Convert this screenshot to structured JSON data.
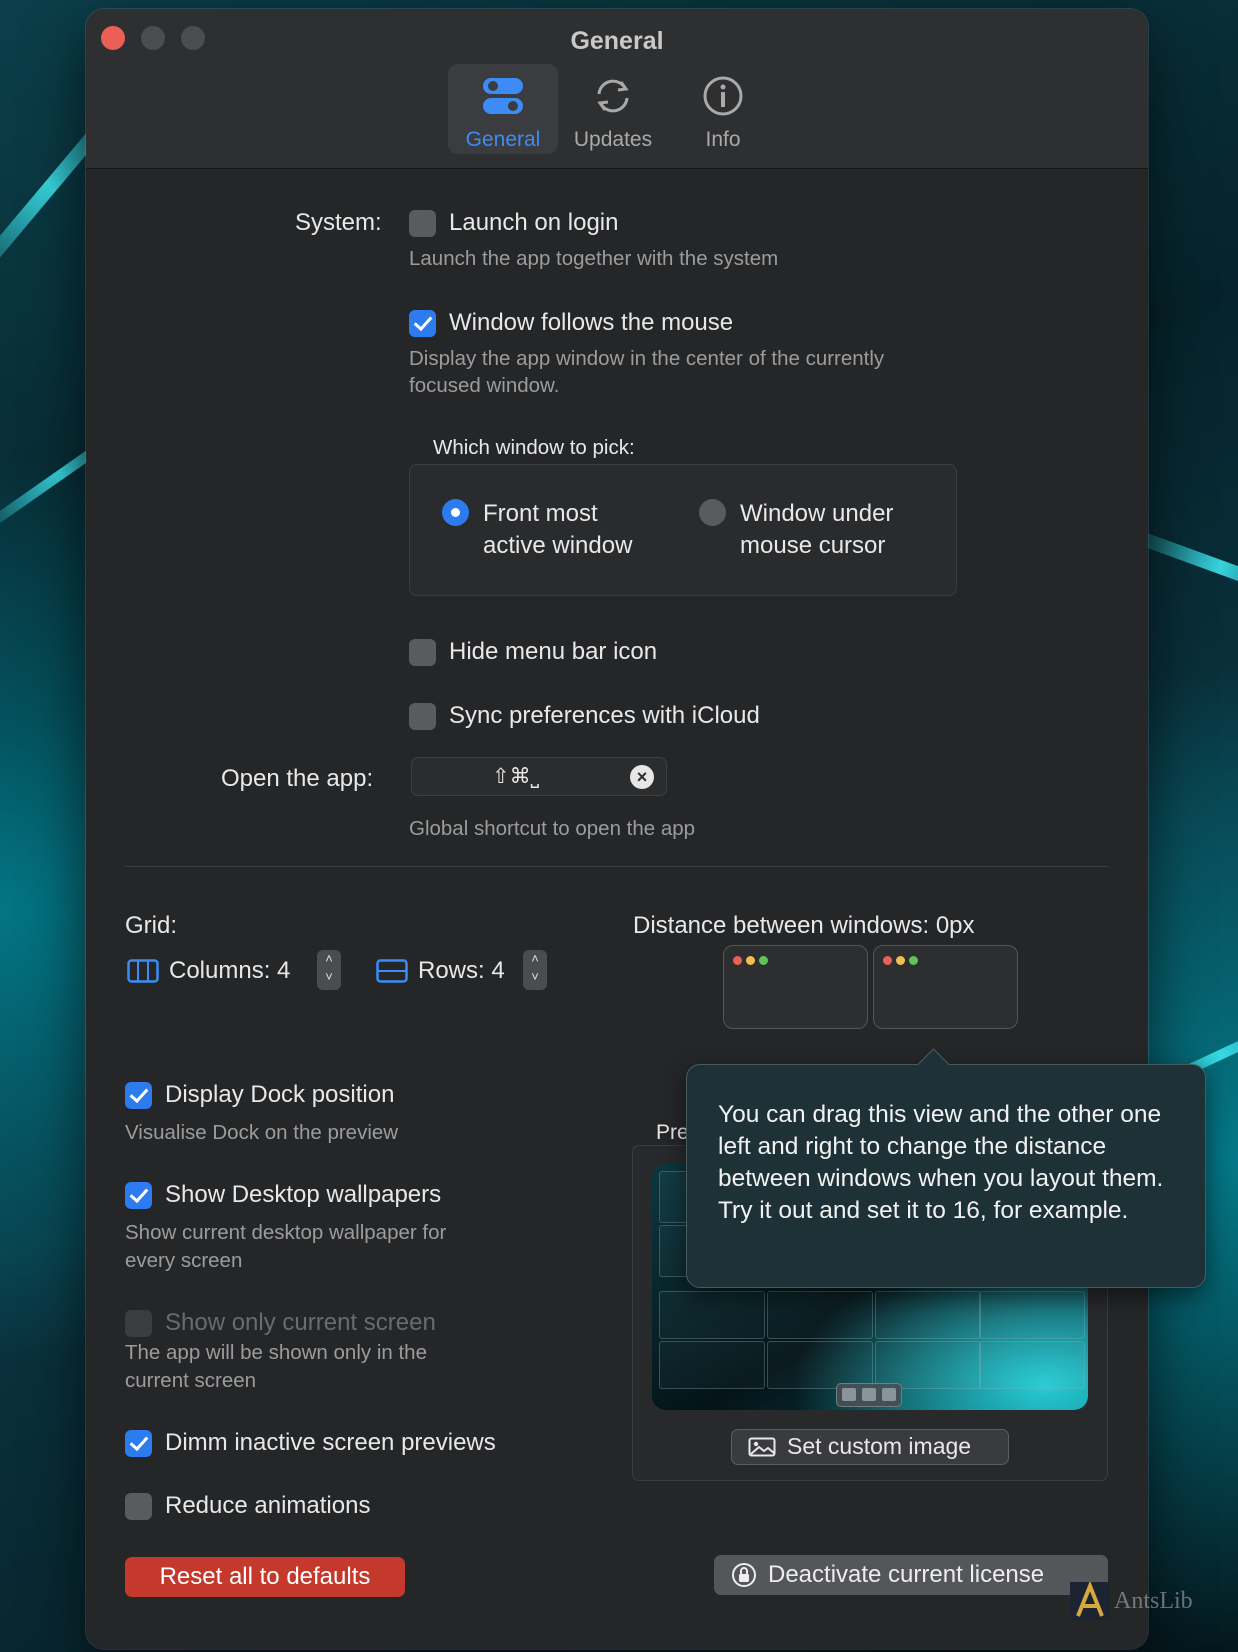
{
  "window": {
    "title": "General"
  },
  "tabs": [
    {
      "label": "General",
      "icon": "toggles-icon",
      "active": true
    },
    {
      "label": "Updates",
      "icon": "refresh-icon",
      "active": false
    },
    {
      "label": "Info",
      "icon": "info-icon",
      "active": false
    }
  ],
  "system": {
    "label": "System:",
    "launch_on_login": {
      "label": "Launch on login",
      "checked": false,
      "description": "Launch the app together with the system"
    },
    "window_follows_mouse": {
      "label": "Window follows the mouse",
      "checked": true,
      "description_line1": "Display the app window in the center of the currently",
      "description_line2": "focused window."
    },
    "which_window": {
      "title": "Which window to pick:",
      "options": [
        {
          "line1": "Front most",
          "line2": "active window",
          "selected": true
        },
        {
          "line1": "Window under",
          "line2": "mouse cursor",
          "selected": false
        }
      ]
    },
    "hide_menu_bar_icon": {
      "label": "Hide menu bar icon",
      "checked": false
    },
    "sync_icloud": {
      "label": "Sync preferences with iCloud",
      "checked": false
    }
  },
  "open_app": {
    "label": "Open the app:",
    "shortcut": "⇧⌘⎵",
    "description": "Global shortcut to open the app"
  },
  "grid": {
    "label": "Grid:",
    "columns_label": "Columns: 4",
    "rows_label": "Rows: 4",
    "columns": 4,
    "rows": 4
  },
  "distance": {
    "label": "Distance between windows: 0px"
  },
  "options": {
    "display_dock": {
      "label": "Display Dock position",
      "checked": true,
      "description": "Visualise Dock on the preview"
    },
    "show_wallpapers": {
      "label": "Show Desktop wallpapers",
      "checked": true,
      "description_line1": "Show current desktop wallpaper for",
      "description_line2": "every screen"
    },
    "only_current_screen": {
      "label": "Show only current screen",
      "checked": false,
      "disabled": true,
      "description_line1": "The app will be shown only in the",
      "description_line2": "current screen"
    },
    "dimm_inactive": {
      "label": "Dimm inactive screen previews",
      "checked": true
    },
    "reduce_animations": {
      "label": "Reduce animations",
      "checked": false
    }
  },
  "preview": {
    "label_partial": "Pre",
    "custom_image_button": "Set custom image"
  },
  "tooltip": {
    "text": "You can drag this view and the other one left and right to change the distance between windows when you layout them. Try it out and set it to 16, for example."
  },
  "buttons": {
    "reset": "Reset all to defaults",
    "deactivate": "Deactivate current license"
  },
  "watermark": {
    "text": "AntsLib"
  },
  "colors": {
    "accent": "#2c7cf0",
    "danger": "#c5382c",
    "window_bg": "#252628"
  }
}
